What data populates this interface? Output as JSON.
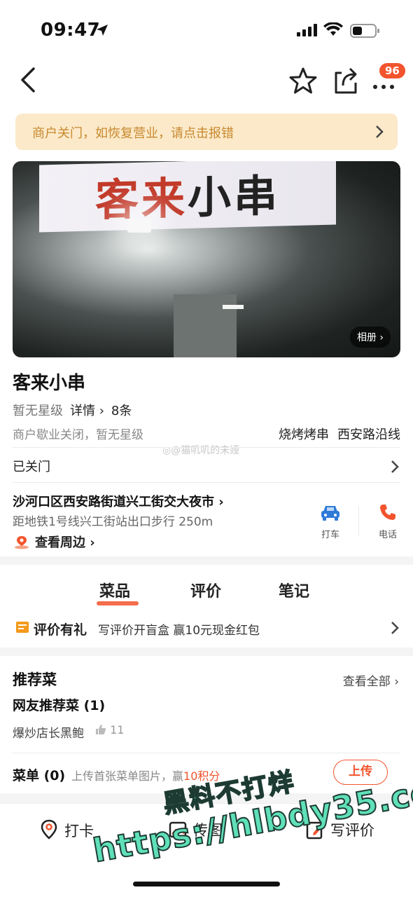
{
  "status_bar": {
    "time": "09:47"
  },
  "nav": {
    "more_badge": "96"
  },
  "closed_banner": {
    "text": "商户关门，如恢复营业，请点击报错"
  },
  "hero": {
    "sign_red": "客来",
    "sign_mid": "小",
    "sign_dark": "串",
    "album_label": "相册 ›"
  },
  "shop": {
    "name": "客来小串",
    "rating": "暂无星级",
    "detail_link": "详情 ›",
    "review_count": "8条",
    "status_note": "商户歇业关闭，暂无星级",
    "categories": [
      "烧烤烤串",
      "西安路沿线"
    ],
    "watermark": "◎@猫叽叽的未娅"
  },
  "hours": {
    "label": "已关门"
  },
  "location": {
    "address": "沙河口区西安路街道兴工街交大夜市 ›",
    "distance": "距地铁1号线兴工街站出口步行 250m",
    "nearby": "查看周边 ›",
    "taxi_label": "打车",
    "phone_label": "电话"
  },
  "tabs": [
    "菜品",
    "评价",
    "笔记"
  ],
  "promo": {
    "title": "评价有礼",
    "desc": "写评价开盲盒 赢10元现金红包"
  },
  "recommend": {
    "title": "推荐菜",
    "view_all": "查看全部 ›",
    "sub_title": "网友推荐菜 (1)",
    "dish": "爆炒店长黑鲍",
    "dish_likes": "11"
  },
  "menu": {
    "label": "菜单 (0)",
    "desc_prefix": "上传首张菜单图片，赢",
    "desc_points": "10积分",
    "upload_label": "上传"
  },
  "bottom_bar": {
    "checkin": "打卡",
    "photo": "传图",
    "write_review": "写评价"
  },
  "overlay_watermark": {
    "line1": "黑料不打烊",
    "line2": "https://hlbdy35.com"
  },
  "colors": {
    "accent": "#f2542d",
    "banner_bg": "#fbe9c9",
    "banner_text": "#c8892e",
    "taxi_blue": "#2f7ad8"
  }
}
